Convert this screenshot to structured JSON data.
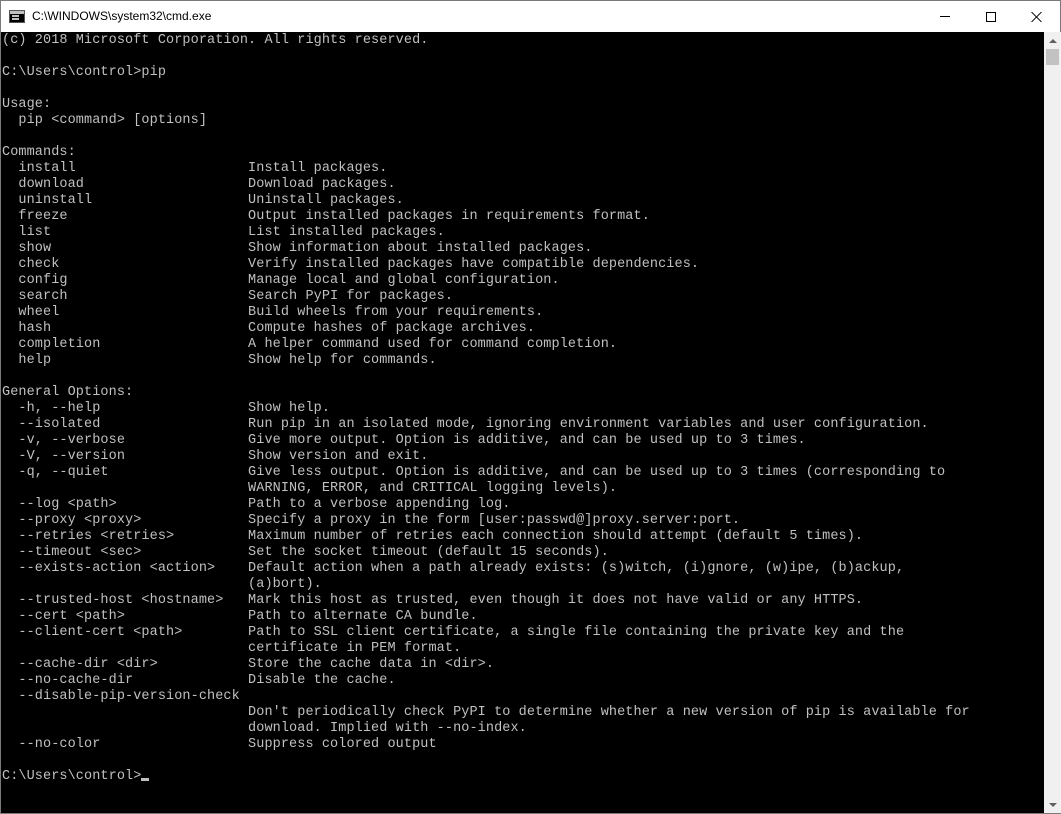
{
  "window": {
    "title": "C:\\WINDOWS\\system32\\cmd.exe",
    "controls": {
      "minimize": "minimize",
      "maximize": "maximize",
      "close": "close"
    }
  },
  "console": {
    "lines": [
      "(c) 2018 Microsoft Corporation. All rights reserved.",
      "",
      "C:\\Users\\control>pip",
      "",
      "Usage:",
      "  pip <command> [options]",
      "",
      "Commands:",
      "  install                     Install packages.",
      "  download                    Download packages.",
      "  uninstall                   Uninstall packages.",
      "  freeze                      Output installed packages in requirements format.",
      "  list                        List installed packages.",
      "  show                        Show information about installed packages.",
      "  check                       Verify installed packages have compatible dependencies.",
      "  config                      Manage local and global configuration.",
      "  search                      Search PyPI for packages.",
      "  wheel                       Build wheels from your requirements.",
      "  hash                        Compute hashes of package archives.",
      "  completion                  A helper command used for command completion.",
      "  help                        Show help for commands.",
      "",
      "General Options:",
      "  -h, --help                  Show help.",
      "  --isolated                  Run pip in an isolated mode, ignoring environment variables and user configuration.",
      "  -v, --verbose               Give more output. Option is additive, and can be used up to 3 times.",
      "  -V, --version               Show version and exit.",
      "  -q, --quiet                 Give less output. Option is additive, and can be used up to 3 times (corresponding to",
      "                              WARNING, ERROR, and CRITICAL logging levels).",
      "  --log <path>                Path to a verbose appending log.",
      "  --proxy <proxy>             Specify a proxy in the form [user:passwd@]proxy.server:port.",
      "  --retries <retries>         Maximum number of retries each connection should attempt (default 5 times).",
      "  --timeout <sec>             Set the socket timeout (default 15 seconds).",
      "  --exists-action <action>    Default action when a path already exists: (s)witch, (i)gnore, (w)ipe, (b)ackup,",
      "                              (a)bort).",
      "  --trusted-host <hostname>   Mark this host as trusted, even though it does not have valid or any HTTPS.",
      "  --cert <path>               Path to alternate CA bundle.",
      "  --client-cert <path>        Path to SSL client certificate, a single file containing the private key and the",
      "                              certificate in PEM format.",
      "  --cache-dir <dir>           Store the cache data in <dir>.",
      "  --no-cache-dir              Disable the cache.",
      "  --disable-pip-version-check",
      "                              Don't periodically check PyPI to determine whether a new version of pip is available for",
      "                              download. Implied with --no-index.",
      "  --no-color                  Suppress colored output",
      ""
    ],
    "prompt": "C:\\Users\\control>"
  },
  "colors": {
    "background": "#000000",
    "foreground": "#c0c0c0",
    "titlebar": "#ffffff"
  }
}
